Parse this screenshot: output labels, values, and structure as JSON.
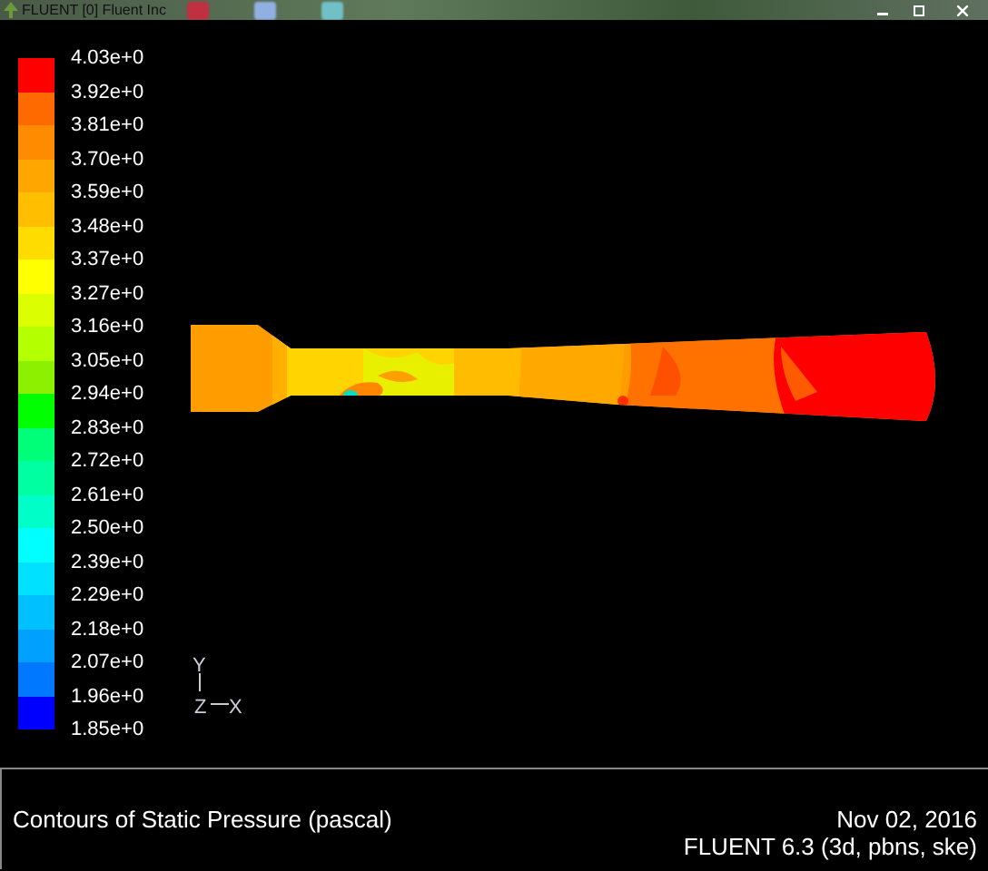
{
  "window": {
    "title": "FLUENT [0] Fluent Inc"
  },
  "legend": {
    "labels": [
      "4.03e+0",
      "3.92e+0",
      "3.81e+0",
      "3.70e+0",
      "3.59e+0",
      "3.48e+0",
      "3.37e+0",
      "3.27e+0",
      "3.16e+0",
      "3.05e+0",
      "2.94e+0",
      "2.83e+0",
      "2.72e+0",
      "2.61e+0",
      "2.50e+0",
      "2.39e+0",
      "2.29e+0",
      "2.18e+0",
      "2.07e+0",
      "1.96e+0",
      "1.85e+0"
    ],
    "bands": [
      {
        "color": "#ff0000"
      },
      {
        "color": "#ff6a00"
      },
      {
        "color": "#ff8c00"
      },
      {
        "color": "#ffa600"
      },
      {
        "color": "#ffbe00"
      },
      {
        "color": "#ffdc00"
      },
      {
        "color": "#ffff00"
      },
      {
        "color": "#dcff00"
      },
      {
        "color": "#b4ff00"
      },
      {
        "color": "#8cf000"
      },
      {
        "color": "#00ff00"
      },
      {
        "color": "#00ff78"
      },
      {
        "color": "#00ffa0"
      },
      {
        "color": "#00ffc8"
      },
      {
        "color": "#00ffff"
      },
      {
        "color": "#00e0ff"
      },
      {
        "color": "#00c0ff"
      },
      {
        "color": "#00a0ff"
      },
      {
        "color": "#0078ff"
      },
      {
        "color": "#0000ff"
      }
    ]
  },
  "triad": {
    "y_label": "Y",
    "z_label": "Z",
    "x_label": "X"
  },
  "caption": {
    "title": "Contours of Static Pressure (pascal)",
    "date": "Nov 02, 2016",
    "version": "FLUENT 6.3 (3d, pbns, ske)"
  }
}
